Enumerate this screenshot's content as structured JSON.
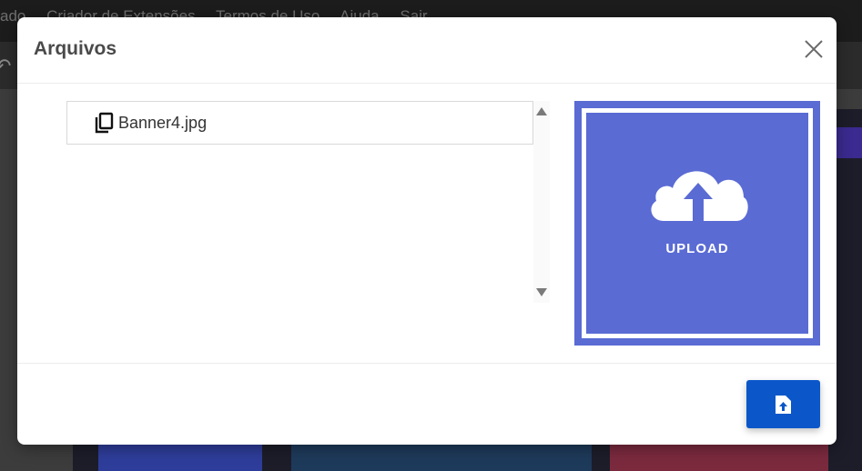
{
  "background_app": {
    "menu": [
      "ado",
      "Criador de Extensões",
      "Termos de Uso",
      "Ajuda",
      "Sair"
    ]
  },
  "modal": {
    "title": "Arquivos",
    "files": [
      {
        "name": "Banner4.jpg",
        "icon": "copy-icon"
      }
    ],
    "upload": {
      "label": "UPLOAD",
      "icon": "cloud-upload-icon"
    },
    "submit_icon": "file-upload-icon"
  },
  "colors": {
    "upload_box": "#5a6bd4",
    "submit_button": "#0b57c9"
  }
}
